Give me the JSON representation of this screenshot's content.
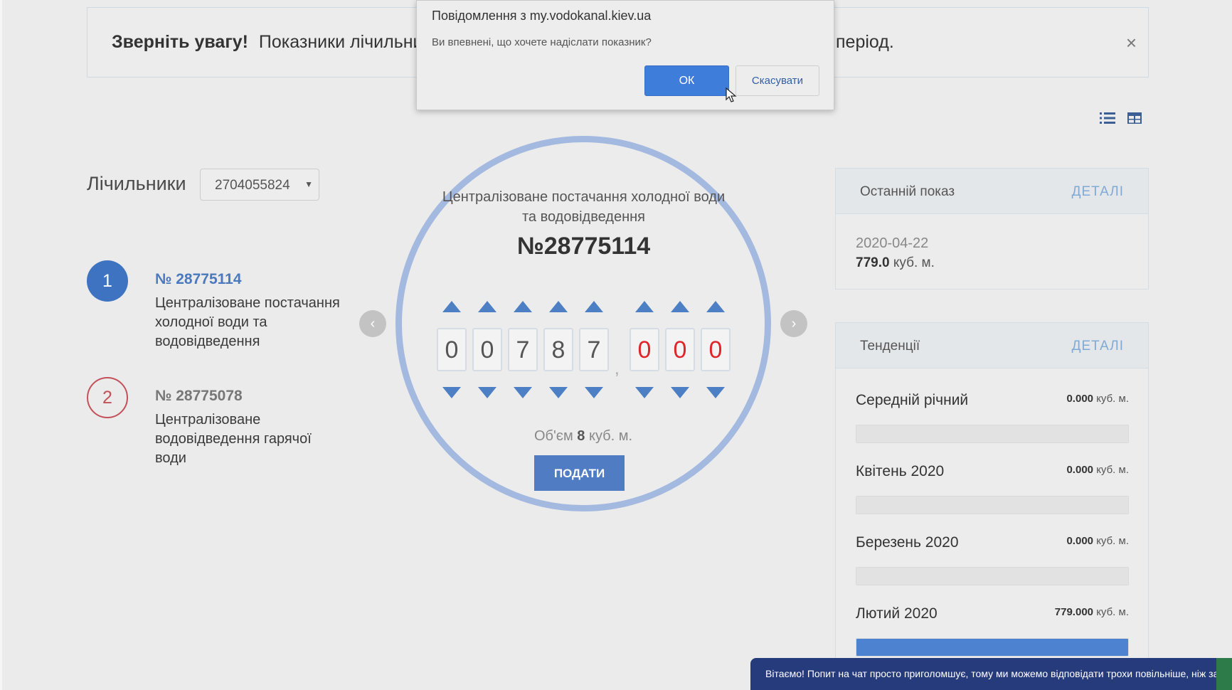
{
  "dialog": {
    "title": "Повідомлення з my.vodokanal.kiev.ua",
    "message": "Ви впевнені, що хочете надіслати показник?",
    "ok_label": "ОК",
    "cancel_label": "Скасувати"
  },
  "alert": {
    "title": "Зверніть увагу!",
    "text": "Показники лічильник",
    "text_tail": "період.",
    "close": "×"
  },
  "meters": {
    "label": "Лічильники",
    "selected_account": "2704055824",
    "items": [
      {
        "index": "1",
        "number": "№ 28775114",
        "description": "Централізоване постачання холодної води та водовідведення"
      },
      {
        "index": "2",
        "number": "№ 28775078",
        "description": "Централізоване водовідведення гарячої води"
      }
    ]
  },
  "reading": {
    "service_title": "Централізоване постачання холодної води та водовідведення",
    "meter_number": "№28775114",
    "integer_digits": [
      "0",
      "0",
      "7",
      "8",
      "7"
    ],
    "fraction_digits": [
      "0",
      "0",
      "0"
    ],
    "decimal_separator": ",",
    "volume_prefix": "Об'єм",
    "volume_value": "8",
    "volume_unit": "куб. м.",
    "submit_label": "ПОДАТИ"
  },
  "last_reading": {
    "title": "Останній показ",
    "details_label": "ДЕТАЛІ",
    "date": "2020-04-22",
    "value": "779.0",
    "unit": "куб. м."
  },
  "trends": {
    "title": "Тенденції",
    "details_label": "ДЕТАЛІ",
    "unit": "куб. м.",
    "rows": [
      {
        "label": "Середній річний",
        "value": "0.000",
        "fill": 0
      },
      {
        "label": "Квітень 2020",
        "value": "0.000",
        "fill": 0
      },
      {
        "label": "Березень 2020",
        "value": "0.000",
        "fill": 0
      },
      {
        "label": "Лютий 2020",
        "value": "779.000",
        "fill": 1
      }
    ]
  },
  "chat": {
    "text": "Вітаємо! Попит на чат просто приголомшує, тому ми можемо відповідати трохи повільніше, ніж за"
  },
  "colors": {
    "accent": "#4f7cc2",
    "alert_red": "#e0252a",
    "chat_bg": "#263b7c"
  },
  "icons": {
    "list_view": "list-view-icon",
    "grid_view": "grid-view-icon",
    "prev": "chevron-left-icon",
    "next": "chevron-right-icon"
  }
}
